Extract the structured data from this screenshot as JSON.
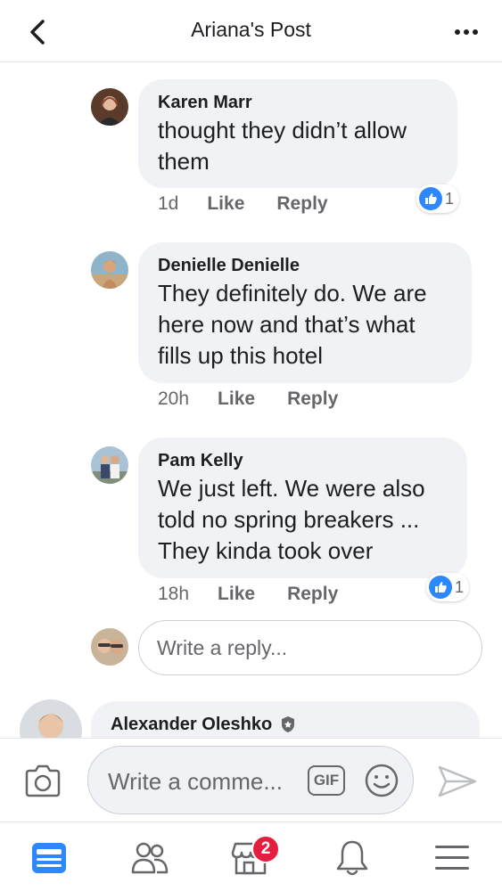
{
  "header": {
    "title": "Ariana's Post",
    "back_icon": "chevron-left-icon",
    "more_icon": "more-dots-icon"
  },
  "comments": [
    {
      "author": "Karen Marr",
      "text_lines": [
        "thought they didn’t allow",
        "them"
      ],
      "time": "1d",
      "like_label": "Like",
      "reply_label": "Reply",
      "reaction_count": "1"
    },
    {
      "author": "Denielle Denielle",
      "text_lines": [
        "They definitely do. We are",
        "here now and that’s what",
        "fills up this hotel"
      ],
      "time": "20h",
      "like_label": "Like",
      "reply_label": "Reply"
    },
    {
      "author": "Pam Kelly",
      "text_lines": [
        "We just left. We were also",
        "told no spring breakers ...",
        "They kinda took over"
      ],
      "time": "18h",
      "like_label": "Like",
      "reply_label": "Reply",
      "reaction_count": "1"
    },
    {
      "author": "Alexander Oleshko",
      "verified_icon": "shield-badge-icon"
    }
  ],
  "reply_box": {
    "placeholder": "Write a reply..."
  },
  "composer": {
    "placeholder": "Write a comme...",
    "gif_label": "GIF",
    "camera_icon": "camera-icon",
    "emoji_icon": "smile-icon",
    "send_icon": "send-icon"
  },
  "tabbar": {
    "items": [
      "news-feed-icon",
      "friends-icon",
      "marketplace-icon",
      "notifications-icon",
      "menu-icon"
    ],
    "marketplace_badge": "2"
  },
  "colors": {
    "accent": "#2d88ff",
    "bubble": "#f0f2f5",
    "badge": "#e41e3f",
    "secondary_text": "#65676b"
  }
}
